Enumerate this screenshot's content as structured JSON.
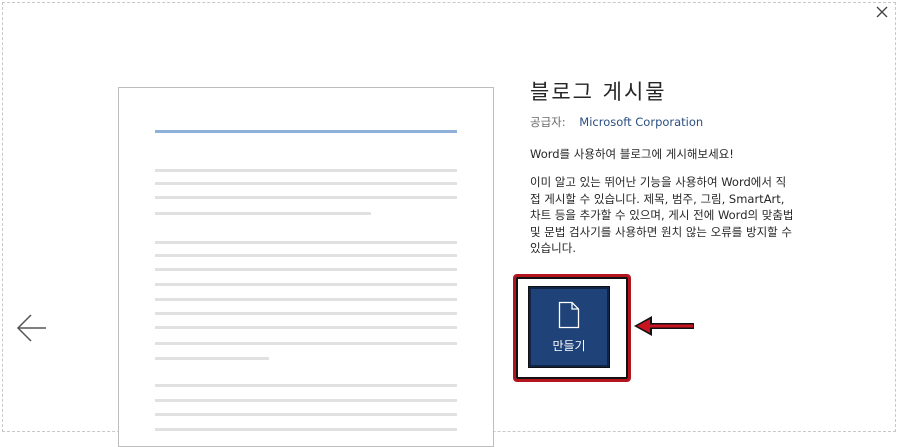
{
  "window": {
    "close_label": "×"
  },
  "product": {
    "title": "블로그 게시물",
    "publisher_label": "공급자:",
    "publisher_name": "Microsoft Corporation",
    "tagline": "Word를 사용하여 블로그에 게시해보세요!",
    "description": "이미 알고 있는 뛰어난 기능을 사용하여 Word에서 직접 게시할 수 있습니다. 제목, 범주, 그림, SmartArt, 차트 등을 추가할 수 있으며, 게시 전에 Word의 맞춤법 및 문법 검사기를 사용하면 원치 않는 오류를 방지할 수 있습니다."
  },
  "create_button": {
    "label": "만들기",
    "icon": "document-icon"
  },
  "navigation": {
    "back_icon": "left-arrow-icon"
  },
  "annotation": {
    "highlight_color": "#b4141e",
    "pointer_icon": "red-arrow-icon"
  },
  "colors": {
    "button_bg": "#1f4279",
    "accent_line": "#8fb0d9",
    "publisher_link": "#2b4f7f"
  }
}
